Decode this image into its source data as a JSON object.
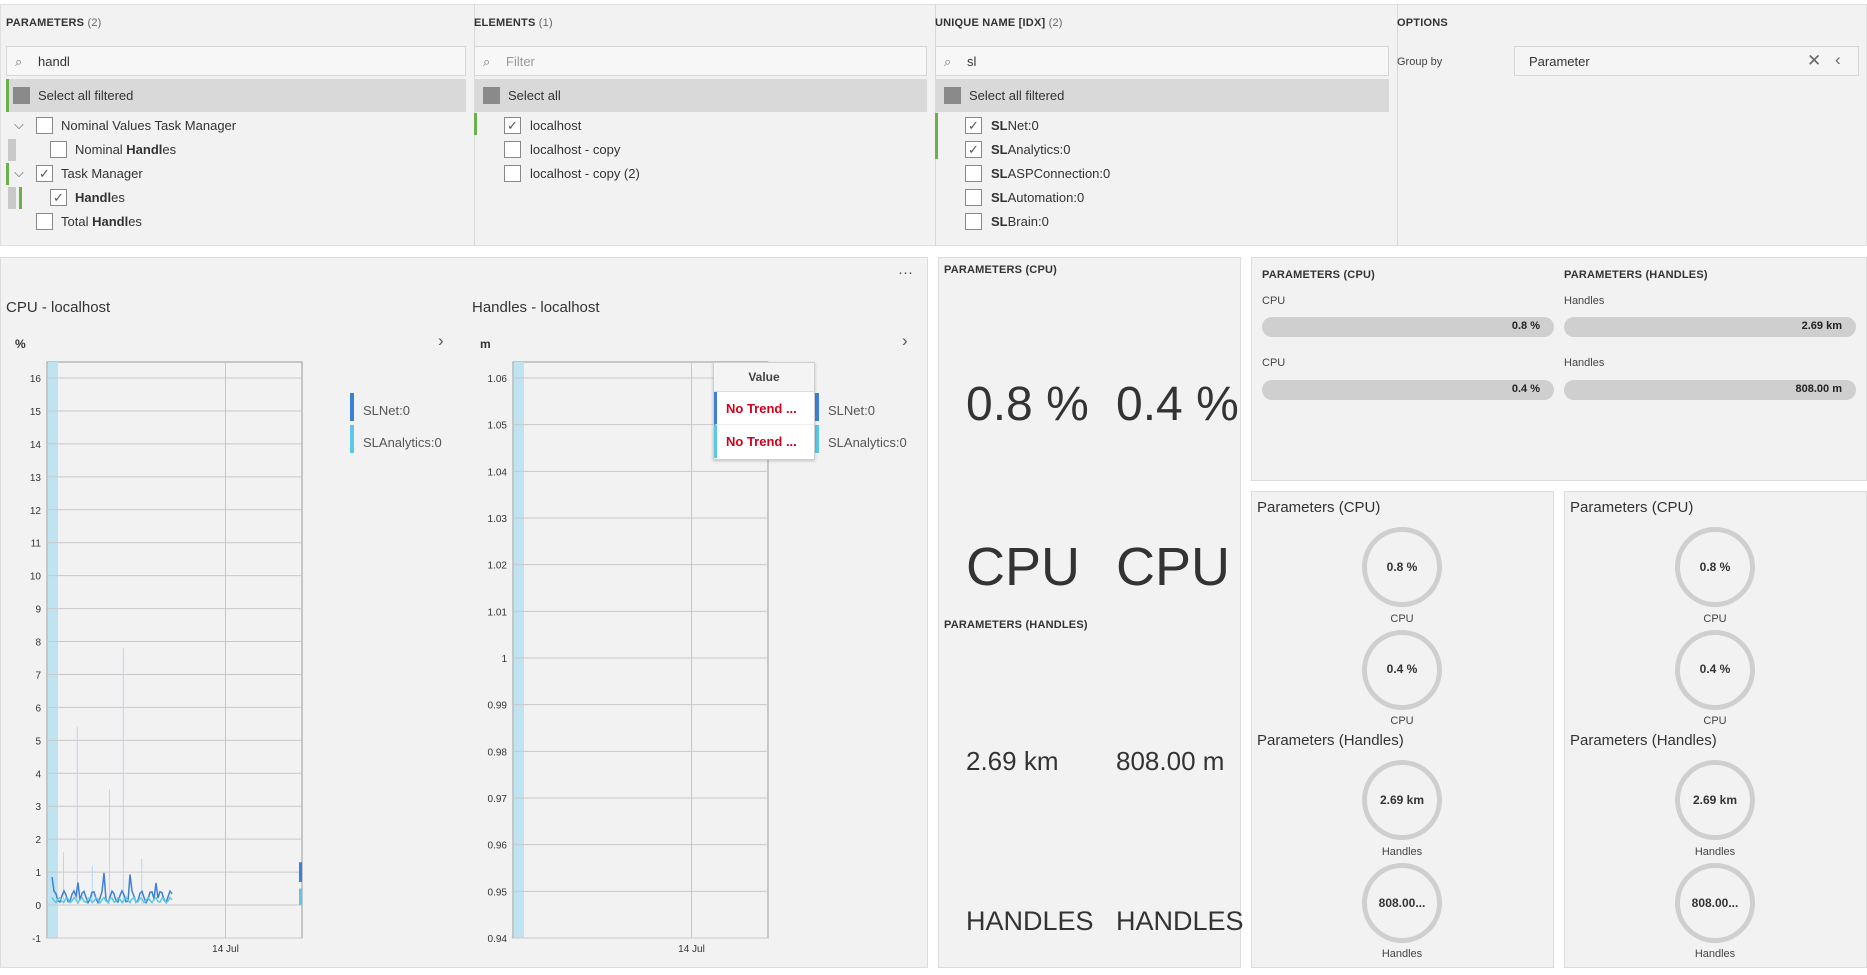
{
  "filters": {
    "parameters": {
      "header": "PARAMETERS",
      "count": "(2)",
      "search_value": "handl",
      "select_all": "Select all filtered",
      "items": [
        {
          "pre": "Nominal Values Task Manager",
          "bold": "",
          "post": ""
        },
        {
          "pre": "Nominal ",
          "bold": "Handl",
          "post": "es"
        },
        {
          "pre": "Task Manager",
          "bold": "",
          "post": ""
        },
        {
          "pre": "",
          "bold": "Handl",
          "post": "es"
        },
        {
          "pre": "Total ",
          "bold": "Handl",
          "post": "es"
        }
      ]
    },
    "elements": {
      "header": "ELEMENTS",
      "count": "(1)",
      "search_placeholder": "Filter",
      "select_all": "Select all",
      "items": [
        "localhost",
        "localhost - copy",
        "localhost - copy (2)"
      ]
    },
    "unique_name": {
      "header": "UNIQUE NAME [IDX]",
      "count": "(2)",
      "search_value": "sl",
      "select_all": "Select all filtered",
      "items": [
        {
          "bold": "SL",
          "post": "Net:0"
        },
        {
          "bold": "SL",
          "post": "Analytics:0"
        },
        {
          "bold": "SL",
          "post": "ASPConnection:0"
        },
        {
          "bold": "SL",
          "post": "Automation:0"
        },
        {
          "bold": "SL",
          "post": "Brain:0"
        }
      ]
    },
    "options": {
      "header": "OPTIONS",
      "group_by_label": "Group by",
      "group_by_value": "Parameter"
    }
  },
  "trend": {
    "more": "···",
    "cpu": {
      "title": "CPU - localhost",
      "unit": "%",
      "yticks": [
        "16",
        "15",
        "14",
        "13",
        "12",
        "11",
        "10",
        "9",
        "8",
        "7",
        "6",
        "5",
        "4",
        "3",
        "2",
        "1",
        "0",
        "-1"
      ],
      "xlabel": "14 Jul",
      "legend": [
        "SLNet:0",
        "SLAnalytics:0"
      ]
    },
    "handles": {
      "title": "Handles - localhost",
      "unit": "m",
      "yticks": [
        "1.06",
        "1.05",
        "1.04",
        "1.03",
        "1.02",
        "1.01",
        "1",
        "0.99",
        "0.98",
        "0.97",
        "0.96",
        "0.95",
        "0.94"
      ],
      "xlabel": "14 Jul",
      "legend": [
        "SLNet:0",
        "SLAnalytics:0"
      ],
      "tooltip": {
        "header": "Value",
        "rows": [
          "No Trend ...",
          "No Trend ..."
        ]
      }
    }
  },
  "state_panel": {
    "cpu_header": "PARAMETERS (CPU)",
    "cpu_values": [
      "0.8 %",
      "0.4 %"
    ],
    "cpu_words": [
      "CPU",
      "CPU"
    ],
    "handles_header": "PARAMETERS (HANDLES)",
    "handles_values": [
      "2.69 km",
      "808.00 m"
    ],
    "handles_words": [
      "HANDLES",
      "HANDLES"
    ]
  },
  "bars_panel": {
    "cpu_header": "PARAMETERS (CPU)",
    "handles_header": "PARAMETERS (HANDLES)",
    "cpu": [
      {
        "label": "CPU",
        "value": "0.8 %"
      },
      {
        "label": "CPU",
        "value": "0.4 %"
      }
    ],
    "handles": [
      {
        "label": "Handles",
        "value": "2.69 km"
      },
      {
        "label": "Handles",
        "value": "808.00 m"
      }
    ]
  },
  "gauges": {
    "cpu_title": "Parameters (CPU)",
    "handles_title": "Parameters (Handles)",
    "cpu": [
      {
        "value": "0.8 %",
        "label": "CPU"
      },
      {
        "value": "0.4 %",
        "label": "CPU"
      }
    ],
    "handles": [
      {
        "value": "2.69 km",
        "label": "Handles"
      },
      {
        "value": "808.00...",
        "label": "Handles"
      }
    ]
  },
  "colors": {
    "accent_green": "#6ab04c",
    "series_slnet": "#3f7fd6",
    "series_slanalytics": "#5bc8e6",
    "no_trend_red": "#d0021b"
  }
}
